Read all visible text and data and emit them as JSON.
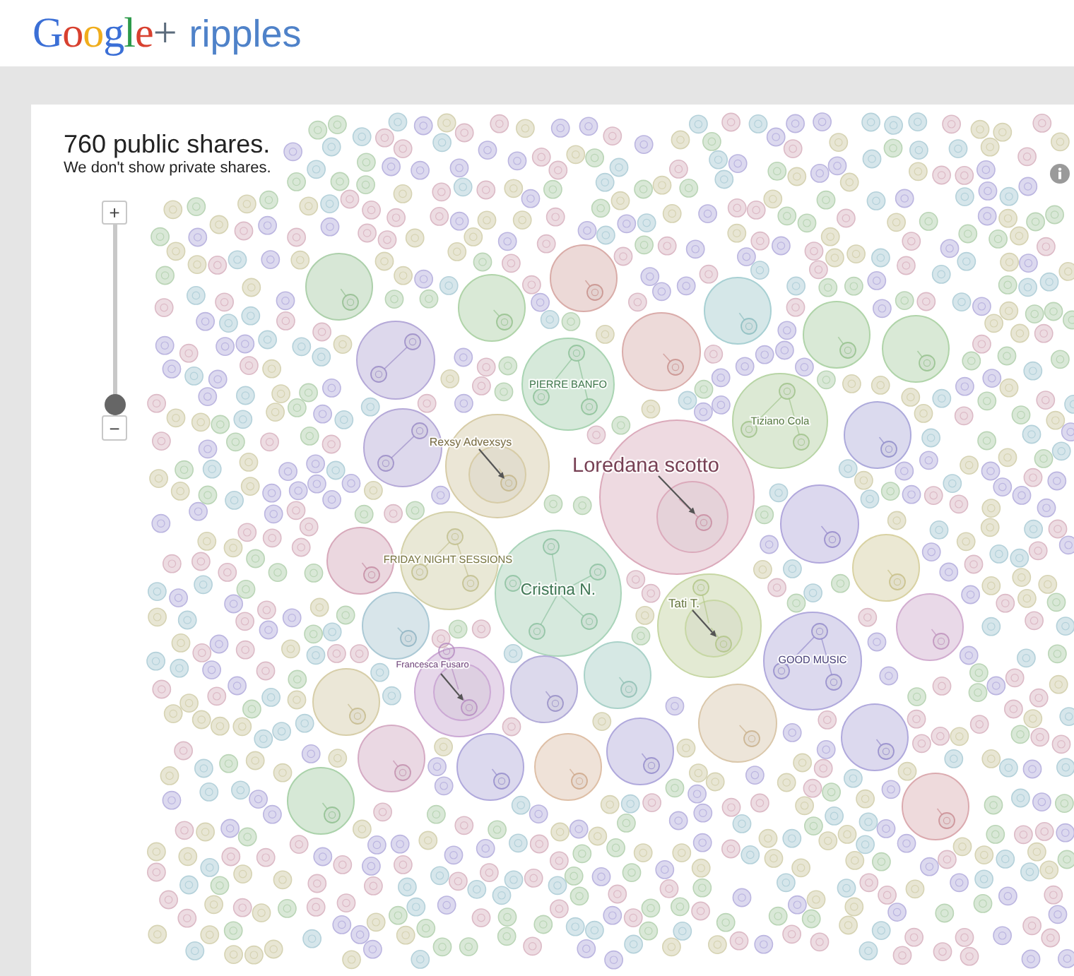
{
  "header": {
    "logo": "Google+",
    "title": "ripples"
  },
  "summary": {
    "count": "760 public shares.",
    "note": "We don't show private shares."
  },
  "zoom": {
    "zoom_in": "+",
    "zoom_out": "−",
    "level": 0
  },
  "ripples": [
    {
      "color": "#d7e7d6"
    },
    {
      "color": "#ecd9d7"
    },
    {
      "color": "#d9e9d6"
    },
    {
      "color": "#d5e7e8"
    },
    {
      "color": "#d9e9d6"
    },
    {
      "color": "#d9e9d6"
    },
    {
      "color": "#eddad9"
    },
    {
      "color": "#ddd8ec"
    },
    {
      "label": "PIERRE BANFO",
      "color": "#d6e9da"
    },
    {
      "label": "Tiziano Cola",
      "color": "#dce9d4"
    },
    {
      "color": "#dbdaee"
    },
    {
      "color": "#ddd8ec"
    },
    {
      "label": "Rexsy Advexsys",
      "color": "#ebe6d6"
    },
    {
      "label": "Loredana scotto",
      "color": "#eedae1"
    },
    {
      "color": "#dcd8ee"
    },
    {
      "color": "#ebd7df"
    },
    {
      "label": "FRIDAY NIGHT SESSIONS",
      "color": "#e9e8d6"
    },
    {
      "color": "#ebe8d3"
    },
    {
      "label": "Cristina N.",
      "color": "#d6e9dd"
    },
    {
      "color": "#d8e5ea"
    },
    {
      "label": "Tati T.",
      "color": "#e3ead3"
    },
    {
      "color": "#e9d9e8"
    },
    {
      "label": "GOOD MUSIC",
      "color": "#dcd9ee"
    },
    {
      "color": "#d6e8e4"
    },
    {
      "color": "#dcd9ec"
    },
    {
      "label": "Francesca Fusaro",
      "color": "#e6d7ea"
    },
    {
      "color": "#ebe7d7"
    },
    {
      "color": "#ede5d9"
    },
    {
      "color": "#dcd9ee"
    },
    {
      "color": "#dcd9ee"
    },
    {
      "color": "#ead8e3"
    },
    {
      "color": "#dcd9ee"
    },
    {
      "color": "#efe2d8"
    },
    {
      "color": "#d6e8d6"
    },
    {
      "color": "#eedadc"
    }
  ]
}
